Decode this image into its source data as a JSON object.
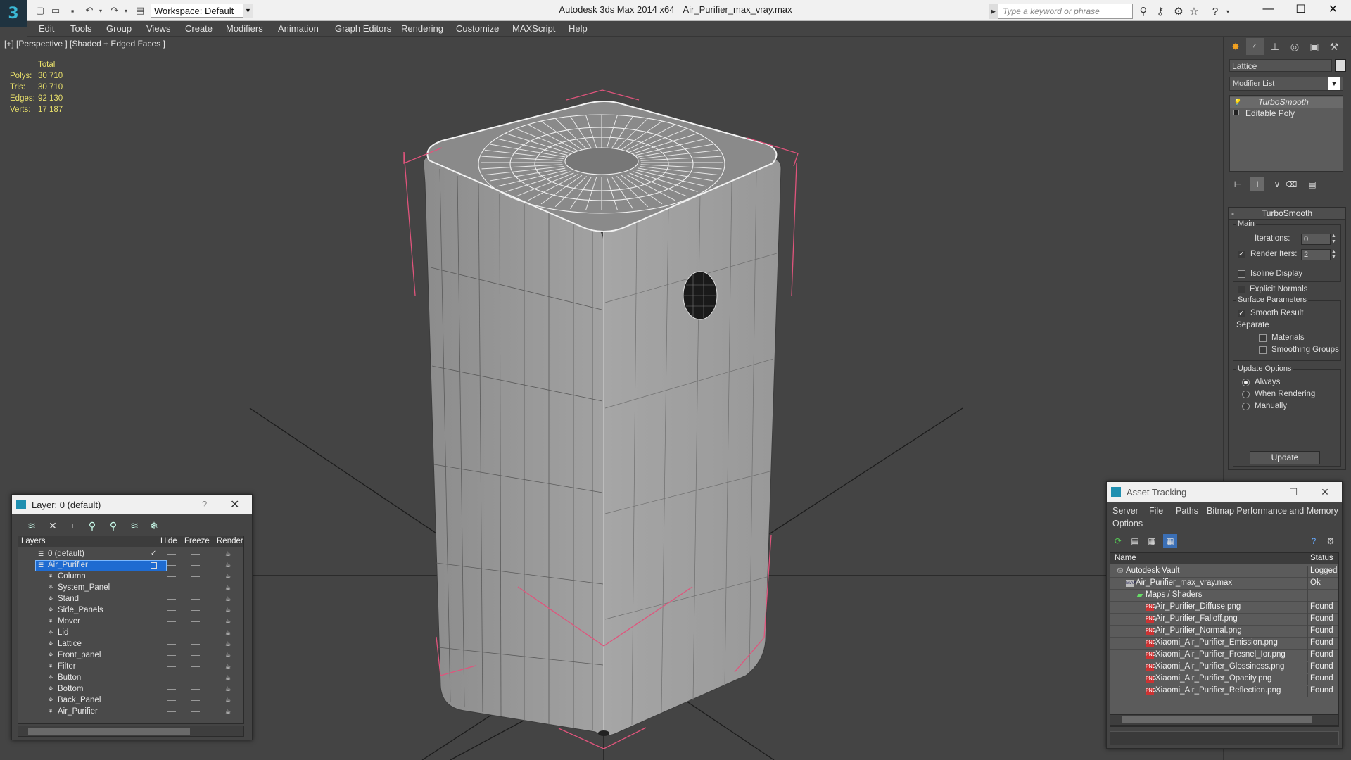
{
  "title_bar": {
    "app_name": "Autodesk 3ds Max  2014 x64",
    "file_name": "Air_Purifier_max_vray.max",
    "workspace_label": "Workspace: Default",
    "search_placeholder": "Type a keyword or phrase"
  },
  "menu": [
    "Edit",
    "Tools",
    "Group",
    "Views",
    "Create",
    "Modifiers",
    "Animation",
    "Graph Editors",
    "Rendering",
    "Customize",
    "MAXScript",
    "Help"
  ],
  "viewport": {
    "label": "[+] [Perspective ] [Shaded + Edged Faces ]",
    "stats": {
      "header": "Total",
      "rows": [
        {
          "key": "Polys:",
          "value": "30 710"
        },
        {
          "key": "Tris:",
          "value": "30 710"
        },
        {
          "key": "Edges:",
          "value": "92 130"
        },
        {
          "key": "Verts:",
          "value": "17 187"
        }
      ]
    }
  },
  "command_panel": {
    "object_name": "Lattice",
    "modifier_list": "Modifier List",
    "stack": [
      "TurboSmooth",
      "Editable Poly"
    ],
    "rollout_title": "TurboSmooth",
    "main_group": "Main",
    "iterations_label": "Iterations:",
    "iterations_value": "0",
    "render_iters_label": "Render Iters:",
    "render_iters_value": "2",
    "isoline": "Isoline Display",
    "explicit_normals": "Explicit Normals",
    "surface_group": "Surface Parameters",
    "smooth_result": "Smooth Result",
    "separate": "Separate",
    "materials": "Materials",
    "smoothing_groups": "Smoothing Groups",
    "update_group": "Update Options",
    "always": "Always",
    "when_rendering": "When Rendering",
    "manually": "Manually",
    "update_button": "Update"
  },
  "layer_window": {
    "title": "Layer: 0 (default)",
    "help": "?",
    "columns": [
      "Layers",
      "Hide",
      "Freeze",
      "Render"
    ],
    "rows": [
      {
        "name": "0 (default)"
      },
      {
        "name": "Air_Purifier"
      },
      {
        "name": "Column"
      },
      {
        "name": "System_Panel"
      },
      {
        "name": "Stand"
      },
      {
        "name": "Side_Panels"
      },
      {
        "name": "Mover"
      },
      {
        "name": "Lid"
      },
      {
        "name": "Lattice"
      },
      {
        "name": "Front_panel"
      },
      {
        "name": "Filter"
      },
      {
        "name": "Button"
      },
      {
        "name": "Bottom"
      },
      {
        "name": "Back_Panel"
      },
      {
        "name": "Air_Purifier"
      }
    ]
  },
  "asset_window": {
    "title": "Asset Tracking",
    "menu": [
      "Server",
      "File",
      "Paths",
      "Bitmap Performance and Memory",
      "Options"
    ],
    "columns": [
      "Name",
      "Status"
    ],
    "rows": [
      {
        "name": "Autodesk Vault",
        "status": "Logged"
      },
      {
        "name": "Air_Purifier_max_vray.max",
        "status": "Ok"
      },
      {
        "name": "Maps / Shaders",
        "status": ""
      },
      {
        "name": "Air_Purifier_Diffuse.png",
        "status": "Found"
      },
      {
        "name": "Air_Purifier_Falloff.png",
        "status": "Found"
      },
      {
        "name": "Air_Purifier_Normal.png",
        "status": "Found"
      },
      {
        "name": "Xiaomi_Air_Purifier_Emission.png",
        "status": "Found"
      },
      {
        "name": "Xiaomi_Air_Purifier_Fresnel_Ior.png",
        "status": "Found"
      },
      {
        "name": "Xiaomi_Air_Purifier_Glossiness.png",
        "status": "Found"
      },
      {
        "name": "Xiaomi_Air_Purifier_Opacity.png",
        "status": "Found"
      },
      {
        "name": "Xiaomi_Air_Purifier_Reflection.png",
        "status": "Found"
      }
    ]
  },
  "colors": {
    "stats_text": "#e8df6a",
    "selection": "#1e6bd1",
    "bounding_box": "#e0547c",
    "viewport_bg": "#444444"
  }
}
